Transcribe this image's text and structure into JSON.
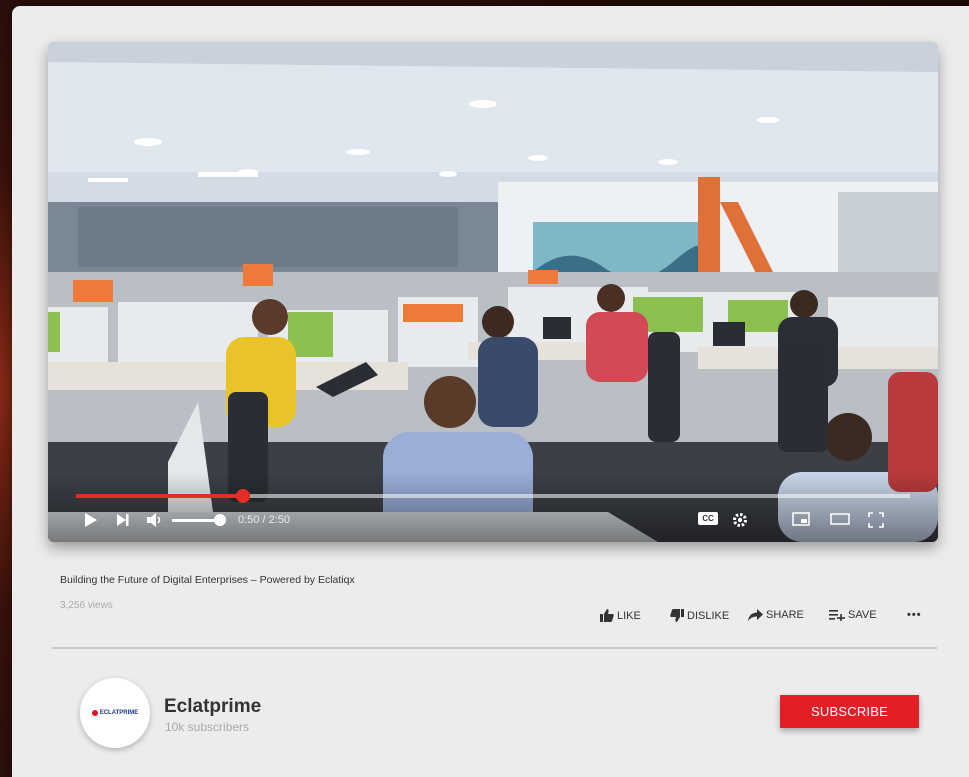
{
  "player": {
    "progress_fraction": 0.2,
    "current_time": "0:50",
    "duration": "2:50",
    "time_display": "0:50 / 2:50",
    "cc_label": "CC"
  },
  "video": {
    "title": "Building the Future of Digital Enterprises – Powered by Eclatiqx",
    "views": "3,256 views"
  },
  "actions": {
    "like": "LIKE",
    "dislike": "DISLIKE",
    "share": "SHARE",
    "save": "SAVE",
    "more": "•••"
  },
  "channel": {
    "name": "Eclatprime",
    "subscribers": "10k subscribers",
    "logo_text": "ECLATPRIME"
  },
  "subscribe_label": "SUBSCRIBE",
  "colors": {
    "accent_red": "#e31e24",
    "progress_red": "#e52d27"
  }
}
